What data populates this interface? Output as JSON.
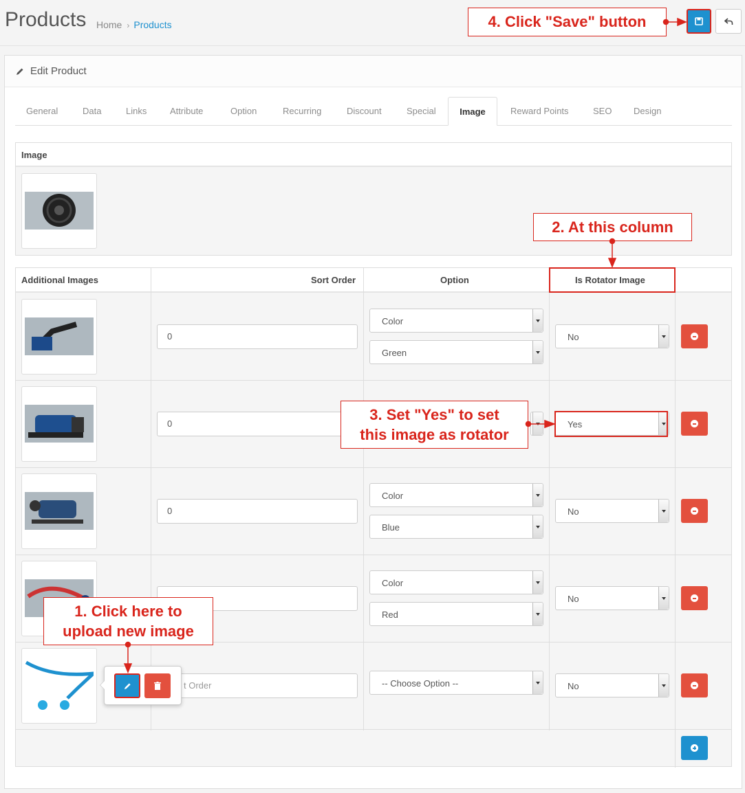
{
  "header": {
    "title": "Products",
    "breadcrumb": [
      {
        "label": "Home"
      },
      {
        "label": "Products"
      }
    ],
    "save_icon": "save-icon",
    "back_icon": "reply-icon"
  },
  "panel": {
    "title": "Edit Product",
    "icon": "pencil-icon"
  },
  "tabs": [
    "General",
    "Data",
    "Links",
    "Attribute",
    "Option",
    "Recurring",
    "Discount",
    "Special",
    "Image",
    "Reward Points",
    "SEO",
    "Design"
  ],
  "active_tab": "Image",
  "image_section": {
    "header": "Image"
  },
  "additional_images": {
    "headers": {
      "image": "Additional Images",
      "sort_order": "Sort Order",
      "option": "Option",
      "rotator": "Is Rotator Image"
    },
    "rows": [
      {
        "sort_order": "0",
        "option_type": "Color",
        "option_value": "Green",
        "rotator": "No"
      },
      {
        "sort_order": "0",
        "option_type": "",
        "option_value": "",
        "rotator": "Yes"
      },
      {
        "sort_order": "0",
        "option_type": "Color",
        "option_value": "Blue",
        "rotator": "No"
      },
      {
        "sort_order": "",
        "option_type": "Color",
        "option_value": "Red",
        "rotator": "No"
      },
      {
        "sort_order_placeholder": "t Order",
        "option_type": "-- Choose Option --",
        "option_value": "",
        "rotator": "No"
      }
    ]
  },
  "callouts": {
    "step1": [
      "1. Click here to",
      "upload new image"
    ],
    "step2": "2. At this column",
    "step3": [
      "3. Set \"Yes\" to set",
      "this image as rotator"
    ],
    "step4": "4. Click \"Save\" button"
  },
  "colors": {
    "primary": "#1e91cf",
    "danger": "#e3503e",
    "annotation": "#d9251c"
  }
}
